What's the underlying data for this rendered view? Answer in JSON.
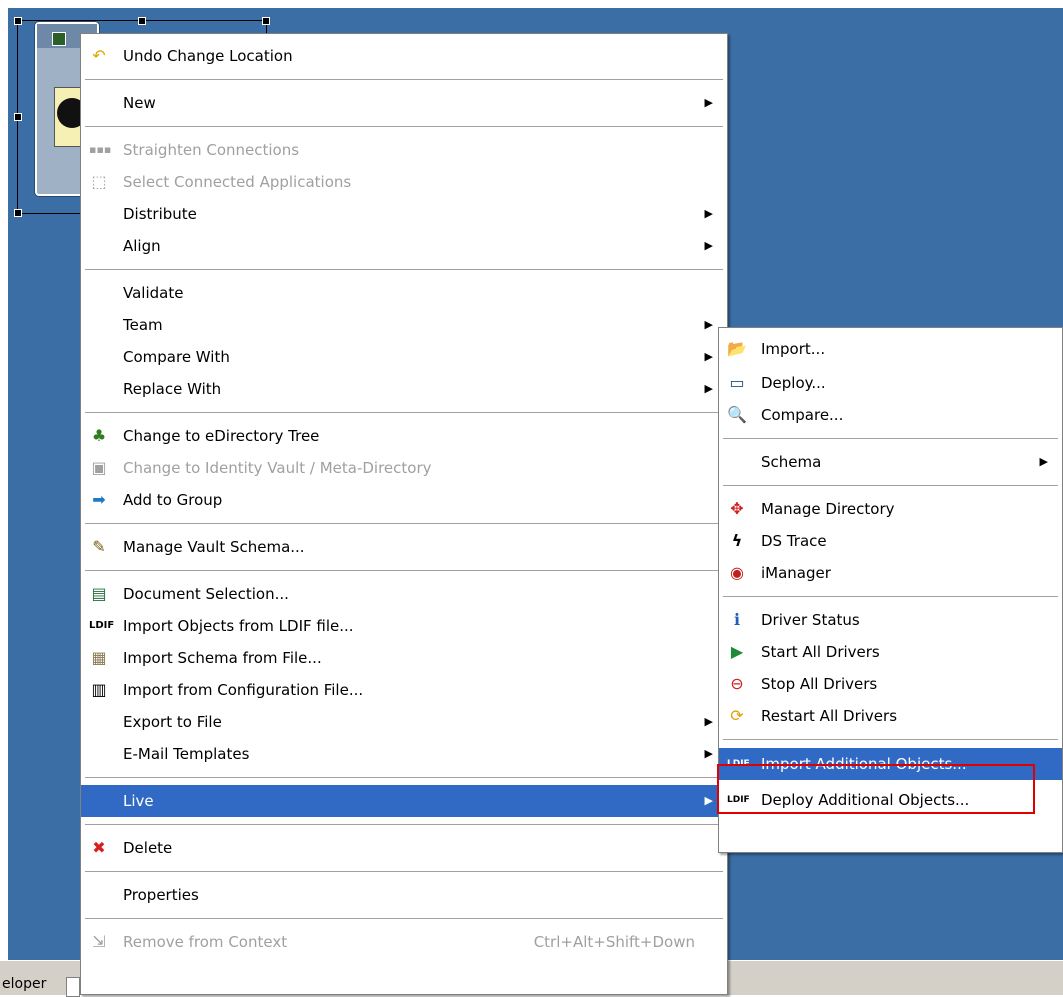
{
  "statusbar": {
    "label": "eloper"
  },
  "main_menu": {
    "items": [
      {
        "label": "Undo Change Location",
        "icon": "undo-icon"
      },
      {
        "label": "New"
      },
      {
        "label": "Straighten Connections",
        "icon": "connections-icon"
      },
      {
        "label": "Select Connected Applications",
        "icon": "selection-icon"
      },
      {
        "label": "Distribute"
      },
      {
        "label": "Align"
      },
      {
        "label": "Validate"
      },
      {
        "label": "Team"
      },
      {
        "label": "Compare With"
      },
      {
        "label": "Replace With"
      },
      {
        "label": "Change to eDirectory Tree",
        "icon": "tree-icon"
      },
      {
        "label": "Change to Identity Vault / Meta-Directory",
        "icon": "vault-icon"
      },
      {
        "label": "Add to Group",
        "icon": "add-group-icon"
      },
      {
        "label": "Manage Vault Schema...",
        "icon": "schema-icon"
      },
      {
        "label": "Document Selection...",
        "icon": "document-icon"
      },
      {
        "label": "Import Objects from LDIF file...",
        "icon": "ldif-icon"
      },
      {
        "label": "Import Schema from File...",
        "icon": "import-schema-icon"
      },
      {
        "label": "Import from Configuration File...",
        "icon": "config-file-icon"
      },
      {
        "label": "Export to File"
      },
      {
        "label": "E-Mail Templates"
      },
      {
        "label": "Live"
      },
      {
        "label": "Delete",
        "icon": "delete-icon"
      },
      {
        "label": "Properties"
      },
      {
        "label": "Remove from Context",
        "icon": "remove-icon",
        "shortcut": "Ctrl+Alt+Shift+Down"
      }
    ]
  },
  "live_submenu": {
    "items": [
      {
        "label": "Import...",
        "icon": "folder-open-icon"
      },
      {
        "label": "Deploy...",
        "icon": "deploy-icon"
      },
      {
        "label": "Compare...",
        "icon": "compare-icon"
      },
      {
        "label": "Schema"
      },
      {
        "label": "Manage Directory",
        "icon": "manage-directory-icon"
      },
      {
        "label": "DS Trace",
        "icon": "trace-icon"
      },
      {
        "label": "iManager",
        "icon": "imanager-icon"
      },
      {
        "label": "Driver Status",
        "icon": "info-icon"
      },
      {
        "label": "Start All Drivers",
        "icon": "play-icon"
      },
      {
        "label": "Stop All Drivers",
        "icon": "stop-icon"
      },
      {
        "label": "Restart All Drivers",
        "icon": "restart-icon"
      },
      {
        "label": "Import Additional Objects...",
        "icon": "ldif-import-icon"
      },
      {
        "label": "Deploy Additional Objects...",
        "icon": "ldif-deploy-icon"
      }
    ]
  },
  "colors": {
    "canvas": "#3b6ea5",
    "highlight": "#316ac5",
    "callout": "#e00000"
  }
}
